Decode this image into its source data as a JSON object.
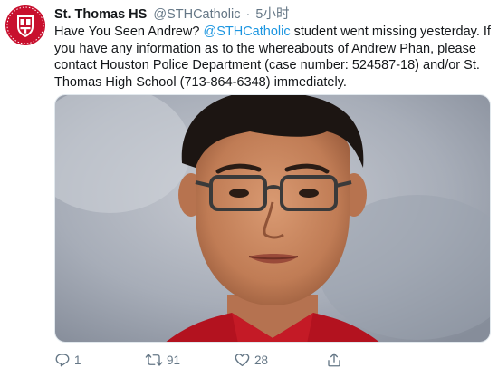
{
  "tweet": {
    "author_name": "St. Thomas HS",
    "author_handle": "@STHCatholic",
    "separator": "·",
    "time": "5小时",
    "text_before_mention": "Have You Seen Andrew? ",
    "mention": "@STHCatholic",
    "text_after_mention": " student went missing yesterday. If you have any information as to the whereabouts of Andrew Phan, please contact Houston Police Department (case number: 524587-18) and/or St. Thomas High School (713-864-6348) immediately."
  },
  "actions": {
    "reply_count": "1",
    "retweet_count": "91",
    "like_count": "28"
  },
  "colors": {
    "avatar_bg": "#c8102e",
    "link": "#1b95e0",
    "muted": "#657786"
  },
  "icons": {
    "avatar": "school-crest-icon",
    "reply": "reply-icon",
    "retweet": "retweet-icon",
    "like": "heart-icon",
    "share": "share-icon"
  }
}
